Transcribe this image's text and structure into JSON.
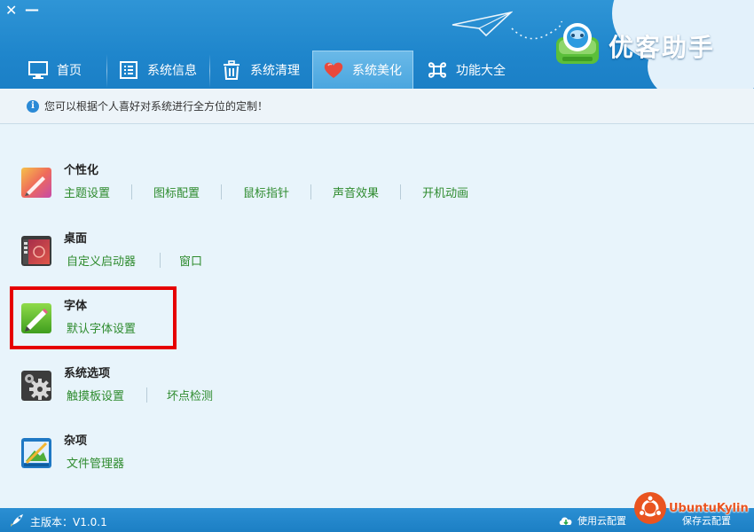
{
  "window": {
    "close_glyph": "✕",
    "minimize_glyph": "—"
  },
  "brand": {
    "name": "优客助手"
  },
  "tabs": [
    {
      "label": "首页",
      "icon": "monitor-icon",
      "active": false
    },
    {
      "label": "系统信息",
      "icon": "list-icon",
      "active": false
    },
    {
      "label": "系统清理",
      "icon": "trash-icon",
      "active": false
    },
    {
      "label": "系统美化",
      "icon": "heart-icon",
      "active": true
    },
    {
      "label": "功能大全",
      "icon": "command-icon",
      "active": false
    }
  ],
  "info": {
    "icon_glyph": "i",
    "text": "您可以根据个人喜好对系统进行全方位的定制！"
  },
  "sections": [
    {
      "title": "个性化",
      "icon": "personalize-icon",
      "links": [
        "主题设置",
        "图标配置",
        "鼠标指针",
        "声音效果",
        "开机动画"
      ]
    },
    {
      "title": "桌面",
      "icon": "desktop-icon",
      "links": [
        "自定义启动器",
        "窗口"
      ]
    },
    {
      "title": "字体",
      "icon": "font-icon",
      "links": [
        "默认字体设置"
      ],
      "highlighted": true
    },
    {
      "title": "系统选项",
      "icon": "gears-icon",
      "links": [
        "触摸板设置",
        "坏点检测"
      ]
    },
    {
      "title": "杂项",
      "icon": "misc-icon",
      "links": [
        "文件管理器"
      ]
    }
  ],
  "footer": {
    "version": "主版本：V1.0.1",
    "use_cloud_label": "使用云配置",
    "save_cloud_label": "保存云配置"
  },
  "watermark": {
    "text": "UbuntuKylin"
  },
  "colors": {
    "accent": "#1f86cc",
    "link": "#2e8b2e",
    "highlight_border": "#e60000",
    "ubuntu_orange": "#e95420"
  }
}
